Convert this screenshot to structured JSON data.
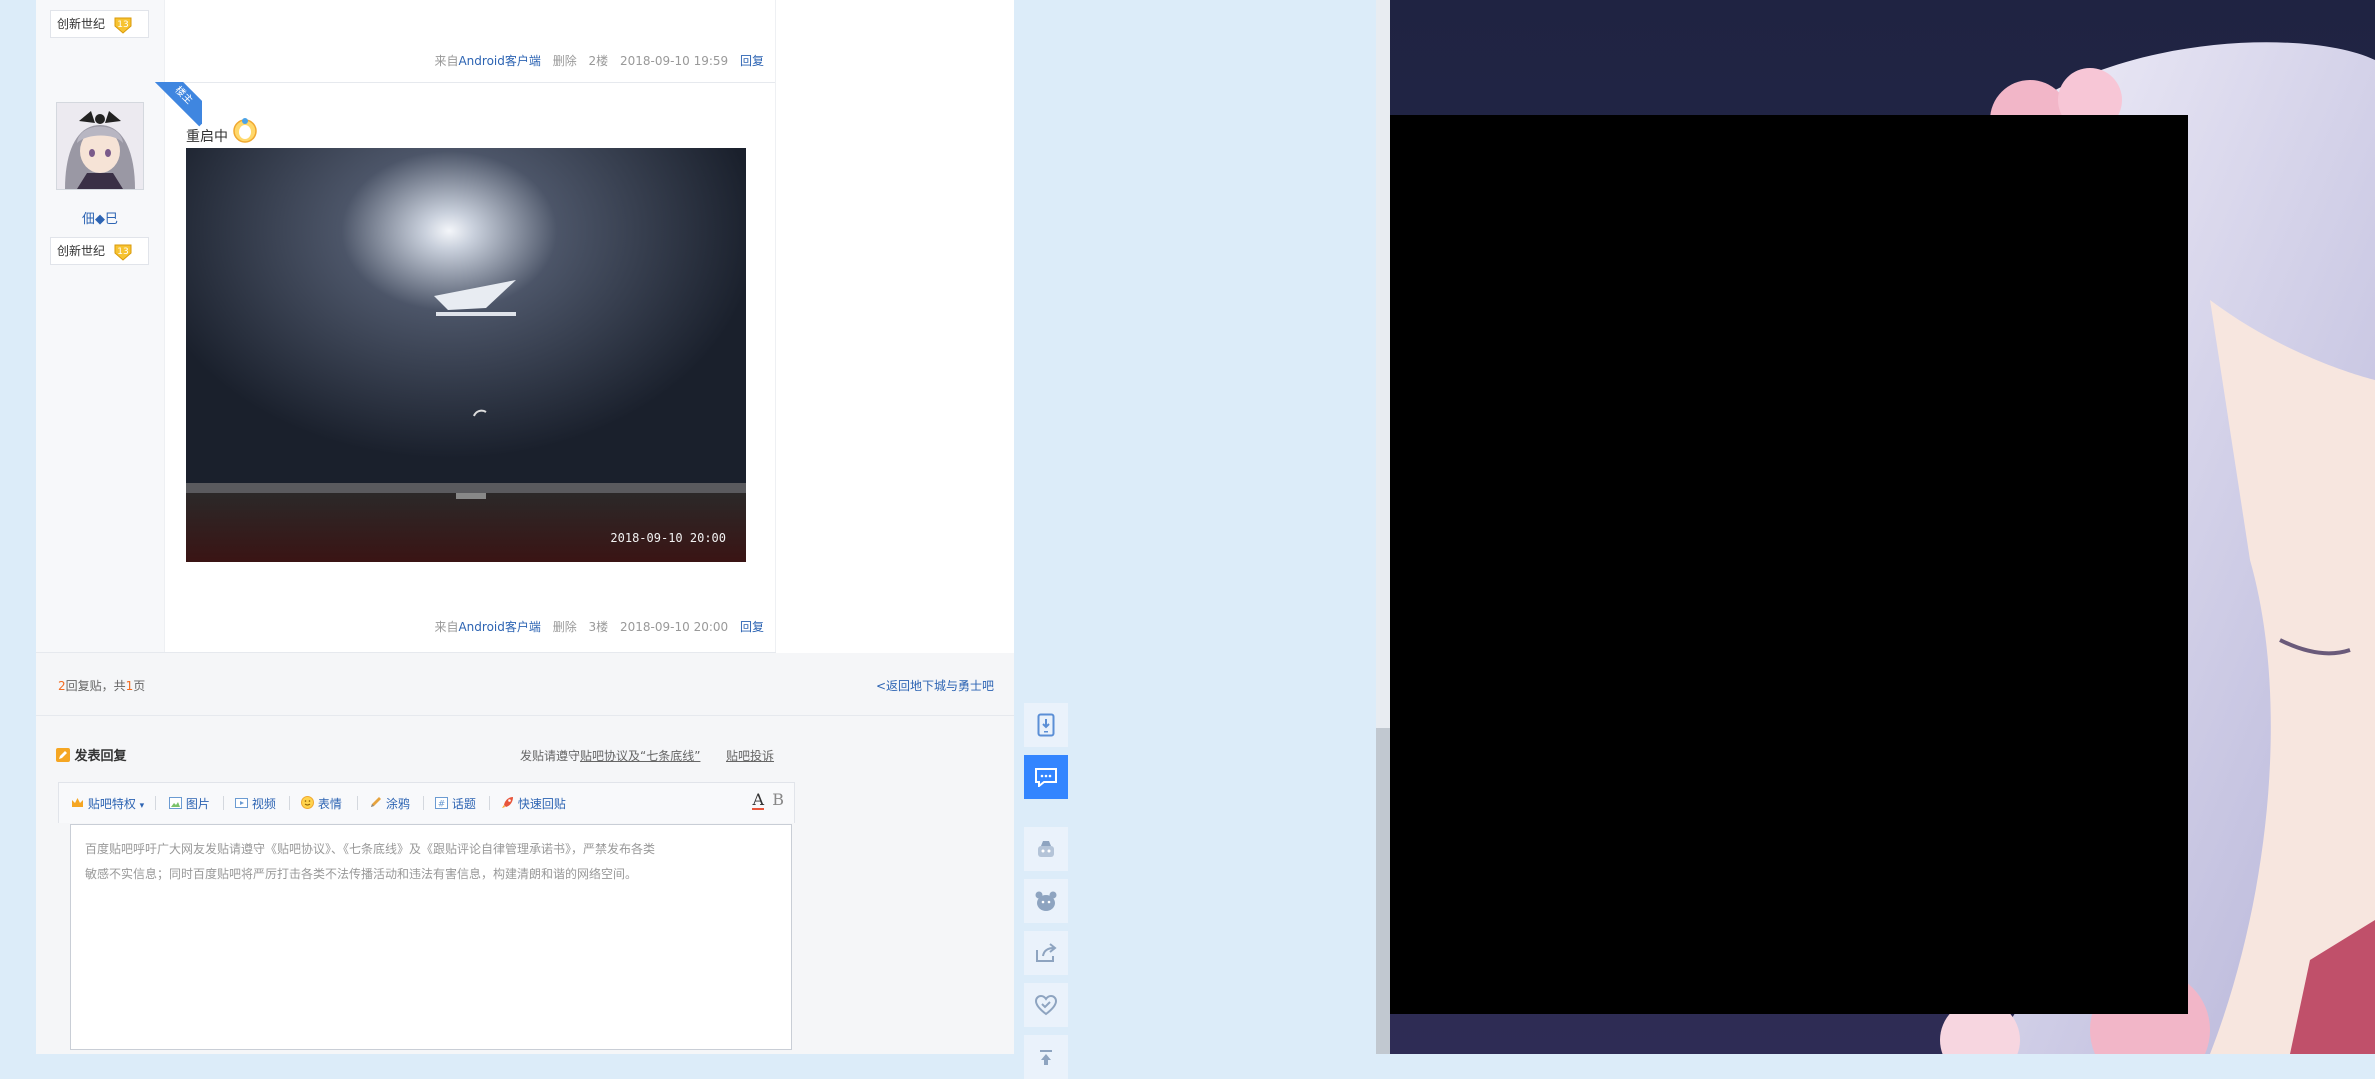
{
  "post2": {
    "badge_name": "创新世纪",
    "badge_level": "13",
    "source_prefix": "来自",
    "source_link": "Android客户端",
    "delete": "删除",
    "floor": "2楼",
    "time": "2018-09-10 19:59",
    "reply": "回复"
  },
  "post3": {
    "ribbon": "楼主",
    "username": "佃◆巳",
    "badge_name": "创新世纪",
    "badge_level": "13",
    "text": "重启中",
    "photo_timestamp": "2018-09-10  20:00",
    "source_prefix": "来自",
    "source_link": "Android客户端",
    "delete": "删除",
    "floor": "3楼",
    "time": "2018-09-10 20:00",
    "reply": "回复"
  },
  "pager": {
    "count": "2",
    "label_mid": "回复贴，共",
    "pages": "1",
    "label_end": "页",
    "back_link": "<返回地下城与勇士吧"
  },
  "editor": {
    "title": "发表回复",
    "notice_prefix": "发贴请遵守",
    "notice_link": "贴吧协议及“七条底线”",
    "complaint_link": "贴吧投诉",
    "toolbar": [
      "贴吧特权",
      "图片",
      "视频",
      "表情",
      "涂鸦",
      "话题",
      "快速回贴"
    ],
    "font_color_btn": "A",
    "bold_btn": "B",
    "placeholder": "百度贴吧呼吁广大网友发贴请遵守《贴吧协议》、《七条底线》及《跟贴评论自律管理承诺书》，严禁发布各类敏感不实信息；同时百度贴吧将严厉打击各类不法传播活动和违法有害信息，构建清朗和谐的网络空间。"
  },
  "sidebar_icons": [
    "phone-download-icon",
    "message-icon",
    "robot-icon",
    "bear-icon",
    "share-icon",
    "heart-icon",
    "top-icon"
  ],
  "colors": {
    "link": "#2d64b3",
    "accent": "#3385ff",
    "page_bg": "#dcecf9",
    "count": "#f36c21"
  }
}
